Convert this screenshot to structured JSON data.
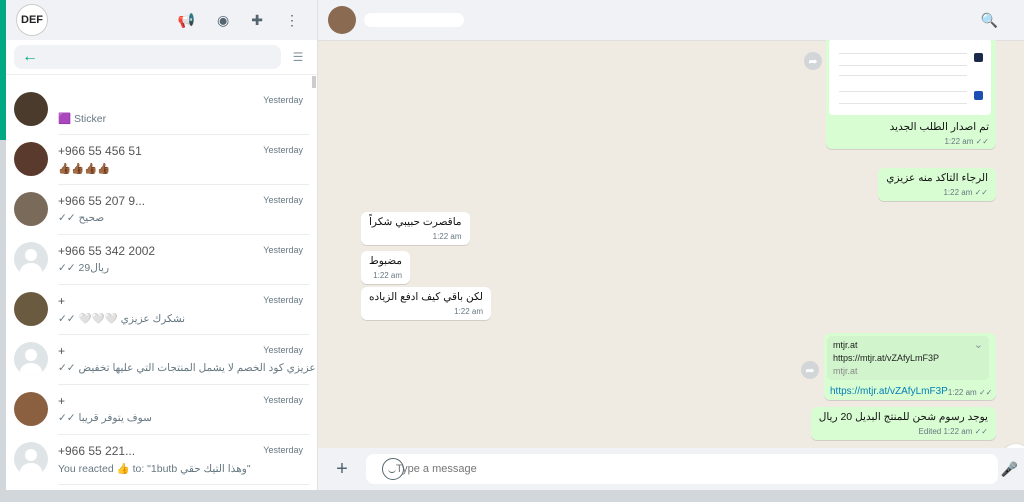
{
  "sidebar": {
    "logo_text": "DEF",
    "icons": [
      "megaphone-icon",
      "status-icon",
      "new-chat-icon",
      "menu-icon"
    ],
    "search_placeholder": "",
    "chats": [
      {
        "name": "",
        "time": "Yesterday",
        "preview": "🟪 Sticker",
        "avatar": "#4a3b2d"
      },
      {
        "name": "+966 55 456 51",
        "time": "Yesterday",
        "preview": "👍🏾👍🏾👍🏾👍🏾",
        "avatar": "#5a3a2d"
      },
      {
        "name": "+966 55 207 9...",
        "time": "Yesterday",
        "preview": "✓✓ صحيح",
        "avatar": "#7a6a5a"
      },
      {
        "name": "+966 55 342 2002",
        "time": "Yesterday",
        "preview": "✓✓ 29ريال",
        "avatar": ""
      },
      {
        "name": "+",
        "time": "Yesterday",
        "preview": "✓✓ 🤍🤍🤍 نشكرك عزيزي",
        "avatar": "#6a5a40"
      },
      {
        "name": "+",
        "time": "Yesterday",
        "preview": "✓✓ عزيزي كود الخصم لا يشمل المنتجات التي عليها تخفيض",
        "avatar": ""
      },
      {
        "name": "+",
        "time": "Yesterday",
        "preview": "✓✓ سوف يتوفر قريبا",
        "avatar": "#8a6040"
      },
      {
        "name": "+966 55 221...",
        "time": "Yesterday",
        "preview": "You reacted 👍 to: \"1butb وهذا التيك حقي\"",
        "avatar": ""
      }
    ]
  },
  "main": {
    "contact_name": "",
    "messages": {
      "m1": {
        "text": "تم اصدار الطلب الجديد",
        "time": "1:22 am",
        "ticks": "✓✓"
      },
      "m2": {
        "text": "الرجاء التاكد منه عزيزي",
        "time": "1:22 am",
        "ticks": "✓✓"
      },
      "m3": {
        "text": "ماقصرت حبيبي شكراً",
        "time": "1:22 am"
      },
      "m4": {
        "text": "مضبوط",
        "time": "1:22 am"
      },
      "m5": {
        "text": "لكن باقي كيف ادفع الزياده",
        "time": "1:22 am"
      },
      "link": {
        "title": "mtjr.at",
        "url_line": "https://mtjr.at/vZAfyLmF3P",
        "domain": "mtjr.at",
        "url": "https://mtjr.at/vZAfyLmF3P",
        "time": "1:22 am",
        "ticks": "✓✓"
      },
      "m6": {
        "text": "يوجد رسوم شحن  للمنتج البديل 20 ريال",
        "edited": "Edited",
        "time": "1:22 am",
        "ticks": "✓✓"
      }
    },
    "composer_placeholder": "Type a message"
  }
}
